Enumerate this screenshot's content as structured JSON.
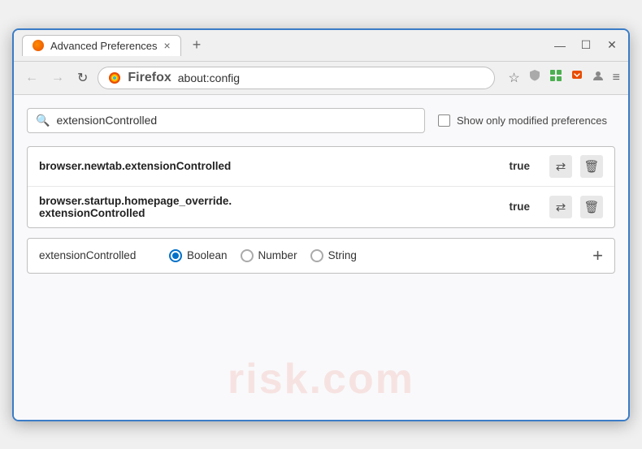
{
  "window": {
    "title": "Advanced Preferences",
    "tab_close": "×",
    "new_tab": "+"
  },
  "window_controls": {
    "minimize": "—",
    "maximize": "☐",
    "close": "✕"
  },
  "nav": {
    "back": "←",
    "forward": "→",
    "reload": "↻",
    "brand": "Firefox",
    "url": "about:config",
    "bookmark": "☆",
    "shield": "⛉",
    "extension": "🧩",
    "pocket": "🅟",
    "profile": "◎",
    "menu": "≡"
  },
  "search": {
    "placeholder": "extensionControlled",
    "value": "extensionControlled",
    "checkbox_label": "Show only modified preferences"
  },
  "preferences": [
    {
      "name": "browser.newtab.extensionControlled",
      "value": "true"
    },
    {
      "name_line1": "browser.startup.homepage_override.",
      "name_line2": "extensionControlled",
      "value": "true"
    }
  ],
  "new_pref": {
    "name": "extensionControlled",
    "types": [
      "Boolean",
      "Number",
      "String"
    ],
    "selected_type": "Boolean",
    "add_label": "+"
  },
  "watermark": "risk.com"
}
